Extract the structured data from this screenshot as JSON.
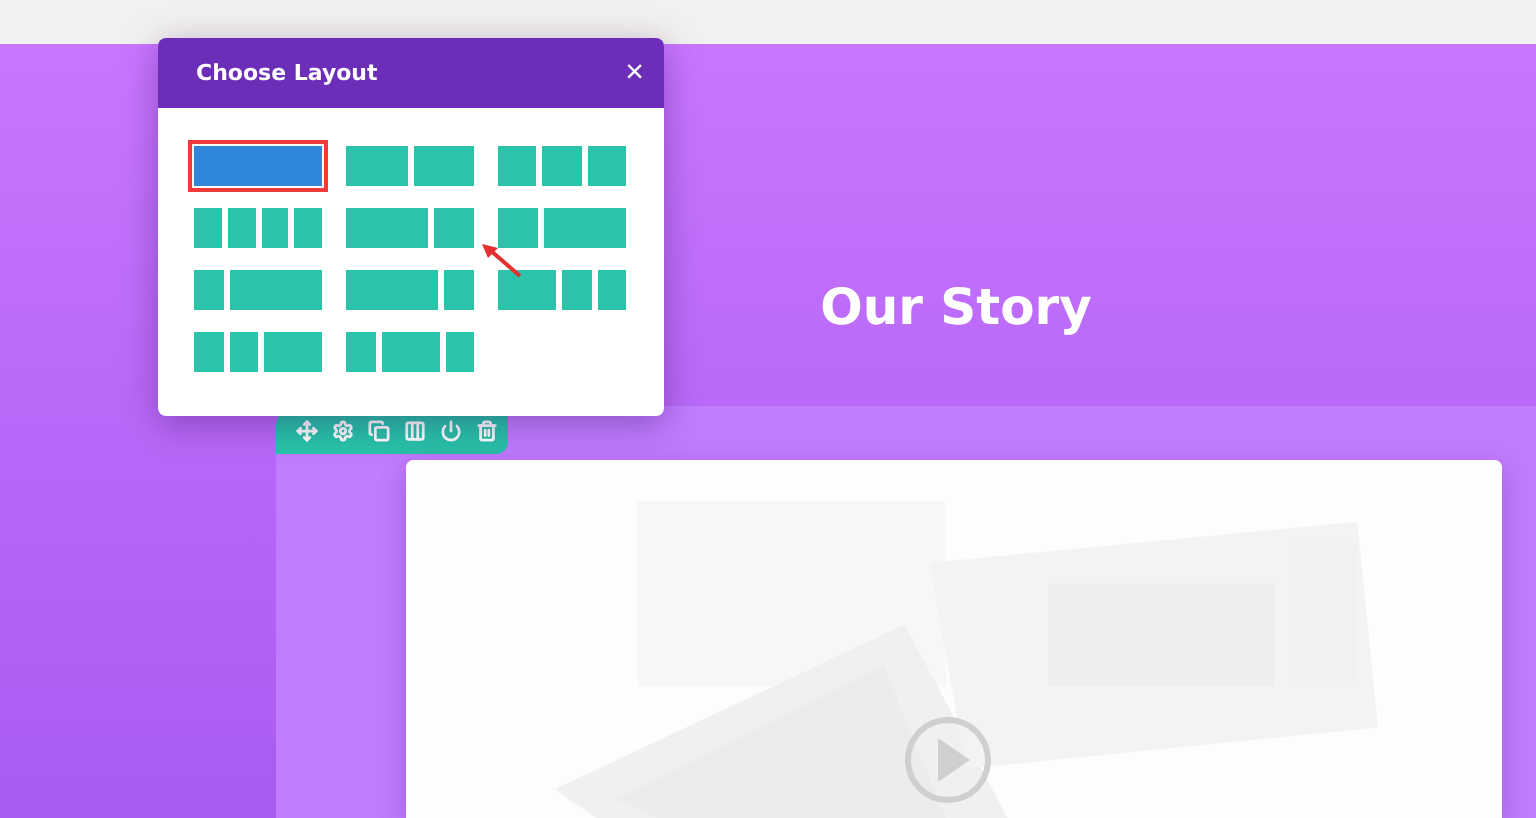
{
  "popup": {
    "title": "Choose Layout",
    "close": "×",
    "layouts": [
      {
        "kind": "full",
        "selected": true
      },
      {
        "kind": "halves",
        "selected": false
      },
      {
        "kind": "thirds",
        "selected": false
      },
      {
        "kind": "quarters",
        "selected": false
      },
      {
        "kind": "wide-narrow",
        "selected": false
      },
      {
        "kind": "narrow-wide",
        "selected": false
      },
      {
        "kind": "quarter-threequarters",
        "selected": false
      },
      {
        "kind": "threequarters-quarter",
        "selected": false
      },
      {
        "kind": "half-quarter-quarter",
        "selected": false
      },
      {
        "kind": "quarter-quarter-half",
        "selected": false
      },
      {
        "kind": "quarter-half-quarter",
        "selected": false
      }
    ]
  },
  "section": {
    "heading": "Our Story"
  },
  "row_toolbar": {
    "tools": [
      {
        "kind": "move"
      },
      {
        "kind": "settings"
      },
      {
        "kind": "duplicate"
      },
      {
        "kind": "columns"
      },
      {
        "kind": "power"
      },
      {
        "kind": "delete"
      }
    ]
  }
}
